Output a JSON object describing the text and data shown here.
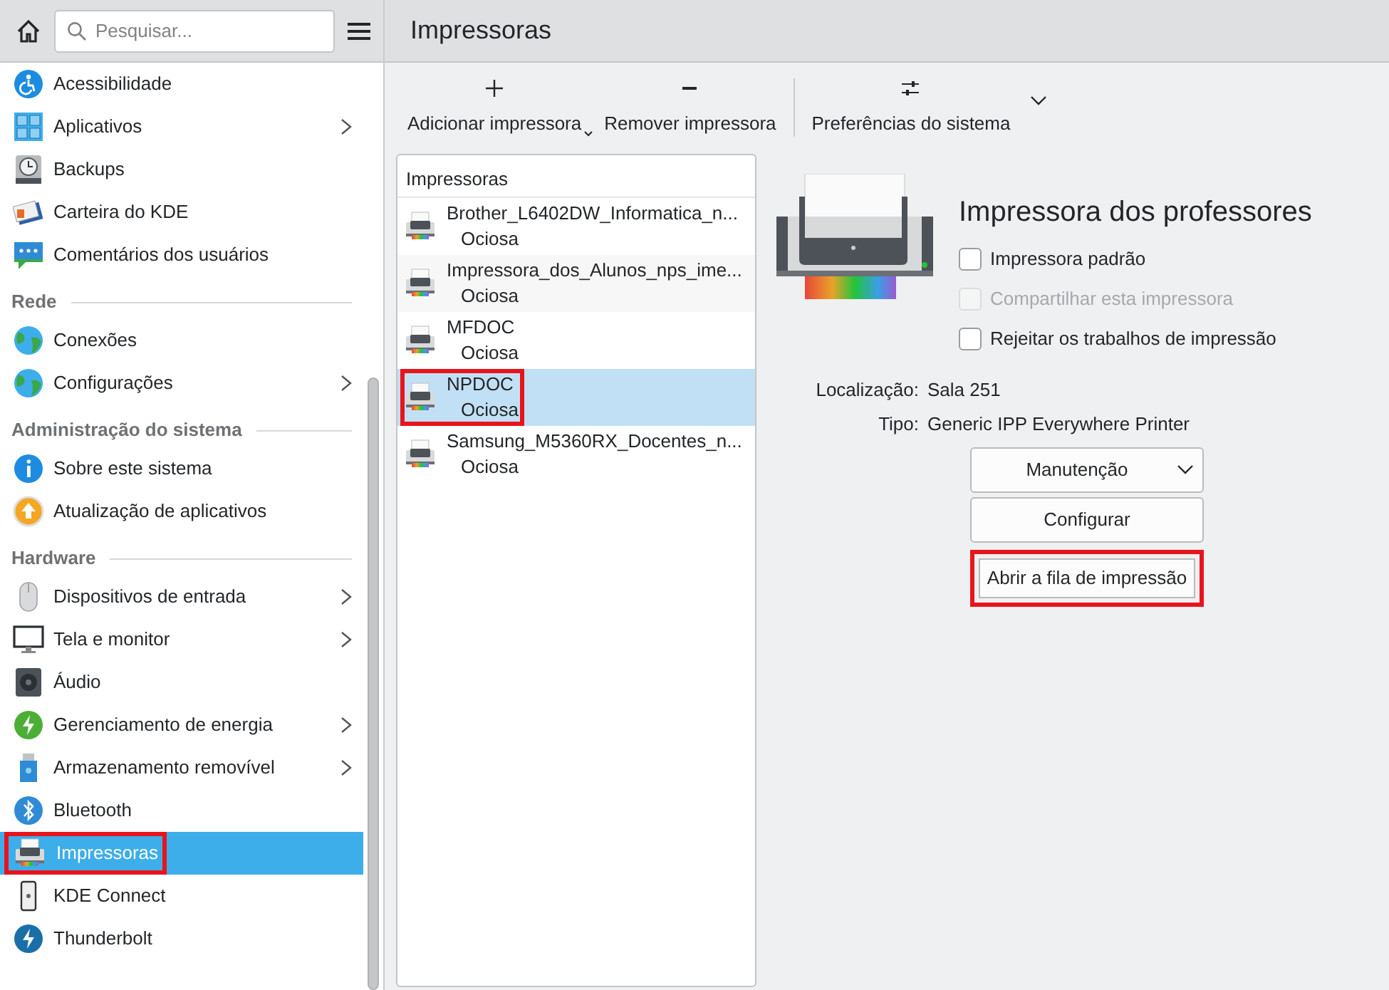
{
  "search": {
    "placeholder": "Pesquisar..."
  },
  "sidebar": {
    "groups": [
      {
        "items": [
          {
            "label": "Acessibilidade",
            "has_submenu": false,
            "selected": false,
            "highlighted": false
          },
          {
            "label": "Aplicativos",
            "has_submenu": true,
            "selected": false,
            "highlighted": false
          },
          {
            "label": "Backups",
            "has_submenu": false,
            "selected": false,
            "highlighted": false
          },
          {
            "label": "Carteira do KDE",
            "has_submenu": false,
            "selected": false,
            "highlighted": false
          },
          {
            "label": "Comentários dos usuários",
            "has_submenu": false,
            "selected": false,
            "highlighted": false
          }
        ]
      },
      {
        "heading": "Rede",
        "items": [
          {
            "label": "Conexões",
            "has_submenu": false,
            "selected": false,
            "highlighted": false
          },
          {
            "label": "Configurações",
            "has_submenu": true,
            "selected": false,
            "highlighted": false
          }
        ]
      },
      {
        "heading": "Administração do sistema",
        "items": [
          {
            "label": "Sobre este sistema",
            "has_submenu": false,
            "selected": false,
            "highlighted": false
          },
          {
            "label": "Atualização de aplicativos",
            "has_submenu": false,
            "selected": false,
            "highlighted": false
          }
        ]
      },
      {
        "heading": "Hardware",
        "items": [
          {
            "label": "Dispositivos de entrada",
            "has_submenu": true,
            "selected": false,
            "highlighted": false
          },
          {
            "label": "Tela e monitor",
            "has_submenu": true,
            "selected": false,
            "highlighted": false
          },
          {
            "label": "Áudio",
            "has_submenu": false,
            "selected": false,
            "highlighted": false
          },
          {
            "label": "Gerenciamento de energia",
            "has_submenu": true,
            "selected": false,
            "highlighted": false
          },
          {
            "label": "Armazenamento removível",
            "has_submenu": true,
            "selected": false,
            "highlighted": false
          },
          {
            "label": "Bluetooth",
            "has_submenu": false,
            "selected": false,
            "highlighted": false
          },
          {
            "label": "Impressoras",
            "has_submenu": false,
            "selected": true,
            "highlighted": true
          },
          {
            "label": "KDE Connect",
            "has_submenu": false,
            "selected": false,
            "highlighted": false
          },
          {
            "label": "Thunderbolt",
            "has_submenu": false,
            "selected": false,
            "highlighted": false
          }
        ]
      }
    ]
  },
  "page": {
    "title": "Impressoras"
  },
  "toolbar": [
    {
      "kind": "add",
      "label": "Adicionar impressora",
      "has_menu": true
    },
    {
      "kind": "remove",
      "label": "Remover impressora",
      "has_menu": false
    },
    {
      "kind": "settings",
      "label": "Preferências do sistema",
      "has_menu": true
    }
  ],
  "printers": {
    "header": "Impressoras",
    "items": [
      {
        "name": "Brother_L6402DW_Informatica_n...",
        "status": "Ociosa",
        "selected": false,
        "highlighted": false
      },
      {
        "name": "Impressora_dos_Alunos_nps_ime...",
        "status": "Ociosa",
        "selected": false,
        "highlighted": false
      },
      {
        "name": "MFDOC",
        "status": "Ociosa",
        "selected": false,
        "highlighted": false
      },
      {
        "name": "NPDOC",
        "status": "Ociosa",
        "selected": true,
        "highlighted": true
      },
      {
        "name": "Samsung_M5360RX_Docentes_n...",
        "status": "Ociosa",
        "selected": false,
        "highlighted": false
      }
    ]
  },
  "details": {
    "title": "Impressora dos professores",
    "options": [
      {
        "label": "Impressora padrão",
        "checked": false,
        "disabled": false
      },
      {
        "label": "Compartilhar esta impressora",
        "checked": false,
        "disabled": true
      },
      {
        "label": "Rejeitar os trabalhos de impressão",
        "checked": false,
        "disabled": false
      }
    ],
    "fields": [
      {
        "label": "Localização:",
        "value": "Sala 251"
      },
      {
        "label": "Tipo:",
        "value": "Generic IPP Everywhere Printer"
      }
    ],
    "buttons": [
      {
        "kind": "dropdown",
        "label": "Manutenção",
        "highlighted": false
      },
      {
        "kind": "button",
        "label": "Configurar",
        "highlighted": false
      },
      {
        "kind": "button",
        "label": "Abrir a fila de impressão",
        "highlighted": true
      }
    ]
  }
}
